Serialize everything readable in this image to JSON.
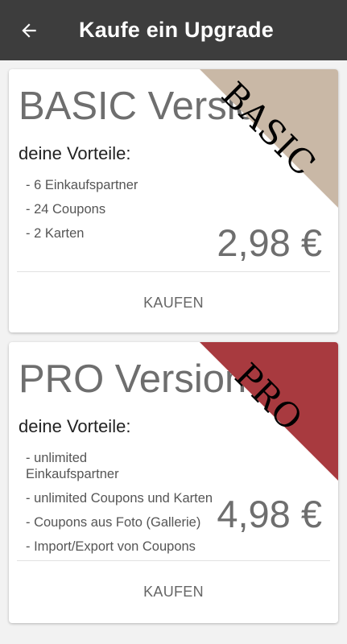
{
  "app_bar": {
    "title": "Kaufe ein Upgrade",
    "back_icon": "arrow-left-icon"
  },
  "plans": {
    "basic": {
      "ribbon": "BASIC",
      "ribbon_color": "#c9b8a6",
      "title": "BASIC Version",
      "subtitle": "deine Vorteile:",
      "features": [
        "- 6 Einkaufspartner",
        "- 24 Coupons",
        "- 2 Karten"
      ],
      "price": "2,98 €",
      "buy_label": "KAUFEN"
    },
    "pro": {
      "ribbon": "PRO",
      "ribbon_color": "#a83a3f",
      "title": "PRO Version",
      "subtitle": "deine Vorteile:",
      "features": [
        "- unlimited Einkaufspartner",
        "- unlimited Coupons und Karten",
        "- Coupons aus Foto (Gallerie)",
        "- Import/Export von Coupons"
      ],
      "price": "4,98 €",
      "buy_label": "KAUFEN"
    }
  }
}
